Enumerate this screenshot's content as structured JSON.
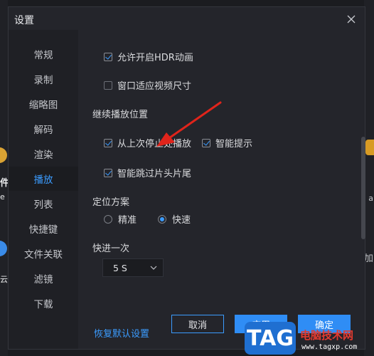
{
  "dialog": {
    "title": "设置"
  },
  "background_peek": {
    "left_labels": [
      "件",
      "e",
      "云"
    ],
    "right_labels": [
      "a",
      "加"
    ]
  },
  "sidebar": {
    "items": [
      {
        "label": "常规",
        "active": false
      },
      {
        "label": "录制",
        "active": false
      },
      {
        "label": "缩略图",
        "active": false
      },
      {
        "label": "解码",
        "active": false
      },
      {
        "label": "渲染",
        "active": false
      },
      {
        "label": "播放",
        "active": true
      },
      {
        "label": "列表",
        "active": false
      },
      {
        "label": "快捷键",
        "active": false
      },
      {
        "label": "文件关联",
        "active": false
      },
      {
        "label": "滤镜",
        "active": false
      },
      {
        "label": "下载",
        "active": false
      }
    ]
  },
  "playback": {
    "allow_hdr": {
      "label": "允许开启HDR动画",
      "checked": true
    },
    "fit_window": {
      "label": "窗口适应视频尺寸",
      "checked": false
    },
    "resume_section": "继续播放位置",
    "resume_last": {
      "label": "从上次停止处播放",
      "checked": true
    },
    "smart_hint": {
      "label": "智能提示",
      "checked": true
    },
    "skip_intro": {
      "label": "智能跳过片头片尾",
      "checked": true
    },
    "seek_section": "定位方案",
    "seek_options": [
      {
        "label": "精准",
        "selected": false
      },
      {
        "label": "快速",
        "selected": true
      }
    ],
    "forward_section": "快进一次",
    "forward_value": "5 S"
  },
  "footer": {
    "restore_label": "恢复默认设置",
    "cancel_label": "取消",
    "apply_label": "应用",
    "ok_label": "确定"
  },
  "watermark": {
    "logo": "TAG",
    "title": "电脑技术网",
    "url": "www.tagxp.com"
  },
  "colors": {
    "accent": "#3b9cff",
    "dialog_bg": "#24252b",
    "sidebar_bg": "#1f2025",
    "annotation_arrow": "#e0241b"
  }
}
